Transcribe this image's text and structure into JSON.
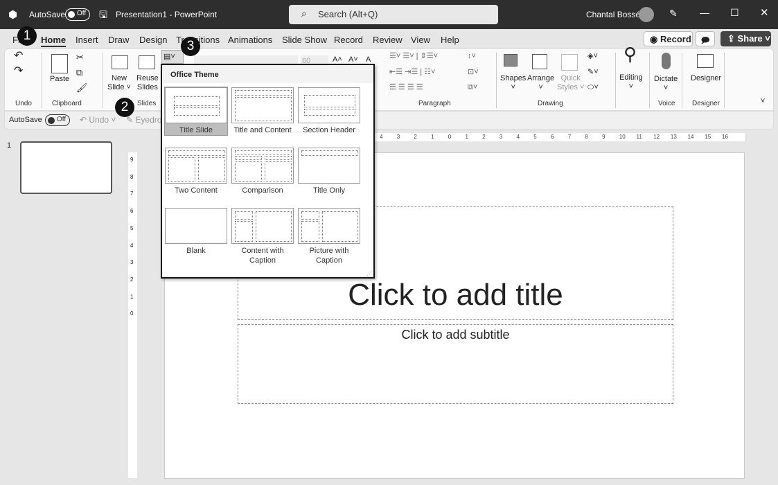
{
  "titlebar": {
    "autosave": "AutoSave",
    "toggle": "Off",
    "doc": "Presentation1 - PowerPoint",
    "search": "Search (Alt+Q)",
    "user": "Chantal Bossé"
  },
  "tabs": [
    "File",
    "Home",
    "Insert",
    "Draw",
    "Design",
    "Transitions",
    "Animations",
    "Slide Show",
    "Record",
    "Review",
    "View",
    "Help"
  ],
  "top_buttons": {
    "record": "Record",
    "share": "Share"
  },
  "ribbon": {
    "groups": {
      "undo": "Undo",
      "clipboard": "Clipboard",
      "slides": "Slides",
      "paragraph": "Paragraph",
      "drawing": "Drawing",
      "voice": "Voice",
      "designer": "Designer"
    },
    "paste": "Paste",
    "new_slide": [
      "New",
      "Slide"
    ],
    "reuse": [
      "Reuse",
      "Slides"
    ],
    "font_size": "60",
    "shapes": "Shapes",
    "arrange": "Arrange",
    "quick_styles": [
      "Quick",
      "Styles"
    ],
    "editing": "Editing",
    "dictate": "Dictate",
    "designer": "Designer"
  },
  "qat": {
    "autosave": "AutoSave",
    "toggle": "Off",
    "undo": "Undo",
    "eyedropper": "Eyedro"
  },
  "badges": [
    "1",
    "2",
    "3"
  ],
  "layout_menu": {
    "header": "Office Theme",
    "layouts": [
      "Title Slide",
      "Title and Content",
      "Section Header",
      "Two Content",
      "Comparison",
      "Title Only",
      "Blank",
      "Content with Caption",
      "Picture with Caption"
    ],
    "selected": "Title Slide"
  },
  "thumbnails": [
    {
      "number": "1"
    }
  ],
  "ruler": {
    "h": [
      "4",
      "3",
      "2",
      "1",
      "0",
      "1",
      "2",
      "3",
      "4",
      "5",
      "6",
      "7",
      "8",
      "9",
      "10",
      "11",
      "12",
      "13",
      "14",
      "15",
      "16"
    ],
    "v": [
      "9",
      "8",
      "7",
      "6",
      "5",
      "4",
      "3",
      "2",
      "1",
      "0"
    ]
  },
  "slide": {
    "title": "Click to add title",
    "subtitle": "Click to add subtitle"
  }
}
